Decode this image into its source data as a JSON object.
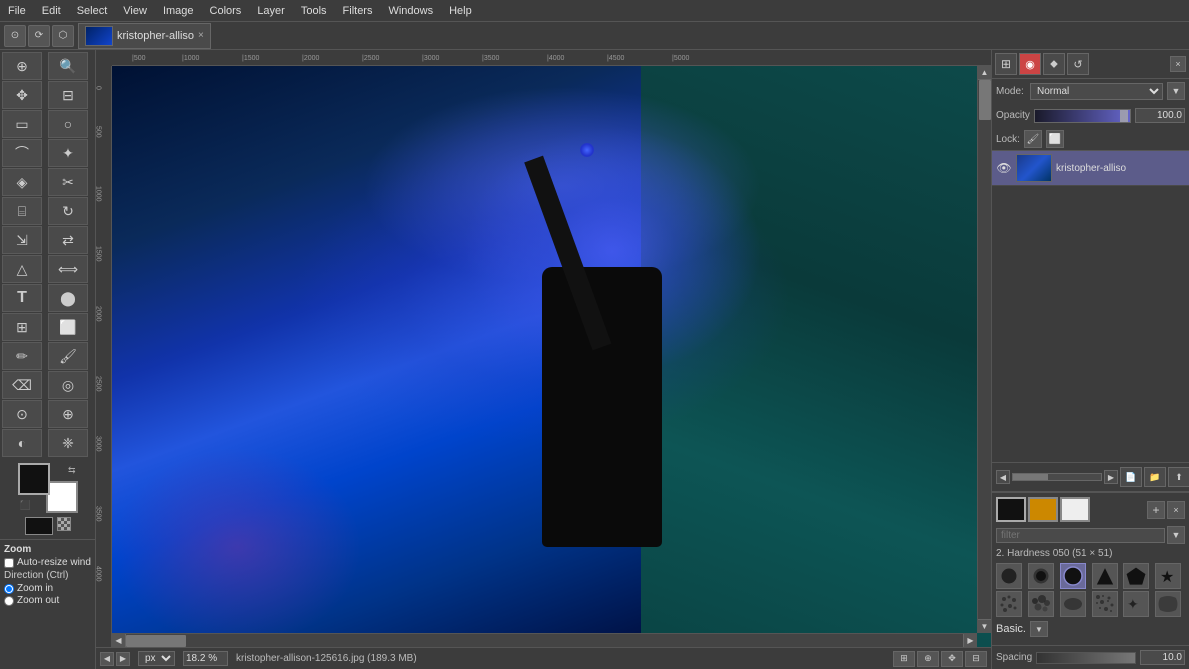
{
  "menubar": {
    "items": [
      "File",
      "Edit",
      "Select",
      "View",
      "Image",
      "Colors",
      "Layer",
      "Tools",
      "Filters",
      "Windows",
      "Help"
    ]
  },
  "toolbar": {
    "tab": {
      "label": "kristopher-alliso",
      "close": "×"
    }
  },
  "mode": {
    "label": "Mode:",
    "value": "Normal"
  },
  "opacity": {
    "label": "Opacity",
    "value": "100.0"
  },
  "lock": {
    "label": "Lock:"
  },
  "layer": {
    "name": "kristopher-alliso",
    "thumb_alt": "layer thumbnail"
  },
  "zoom": {
    "label": "Zoom",
    "auto_resize": "Auto-resize wind",
    "direction_label": "Direction  (Ctrl)",
    "zoom_in": "Zoom in",
    "zoom_out": "Zoom out"
  },
  "statusbar": {
    "nav_left": "◀",
    "nav_right": "▶",
    "unit": "px",
    "zoom_value": "18.2 %",
    "filename": "kristopher-allison-125616.jpg (189.3 MB)"
  },
  "brushes": {
    "section_label": "2. Hardness 050 (51 × 51)",
    "filter_placeholder": "filter",
    "spacing_label": "Spacing",
    "spacing_value": "10.0",
    "category_label": "Basic."
  },
  "tools": [
    {
      "icon": "⊕",
      "name": "color-picker-tool"
    },
    {
      "icon": "✦",
      "name": "zoom-tool"
    },
    {
      "icon": "⌖",
      "name": "move-tool"
    },
    {
      "icon": "○",
      "name": "ellipse-select-tool"
    },
    {
      "icon": "⌒",
      "name": "lasso-tool"
    },
    {
      "icon": "⬤",
      "name": "fuzzy-select-tool"
    },
    {
      "icon": "✂",
      "name": "crop-tool"
    },
    {
      "icon": "⌸",
      "name": "transform-tool"
    },
    {
      "icon": "△",
      "name": "perspective-tool"
    },
    {
      "icon": "⇄",
      "name": "flip-tool"
    },
    {
      "icon": "T",
      "name": "text-tool"
    },
    {
      "icon": "⊞",
      "name": "fill-tool"
    },
    {
      "icon": "⬜",
      "name": "gradient-tool"
    },
    {
      "icon": "✏",
      "name": "pencil-tool"
    },
    {
      "icon": "♾",
      "name": "path-tool"
    },
    {
      "icon": "◈",
      "name": "clone-tool"
    },
    {
      "icon": "⌫",
      "name": "eraser-tool"
    },
    {
      "icon": "⬥",
      "name": "heal-tool"
    },
    {
      "icon": "◐",
      "name": "dodge-tool"
    },
    {
      "icon": "❈",
      "name": "smudge-tool"
    }
  ]
}
